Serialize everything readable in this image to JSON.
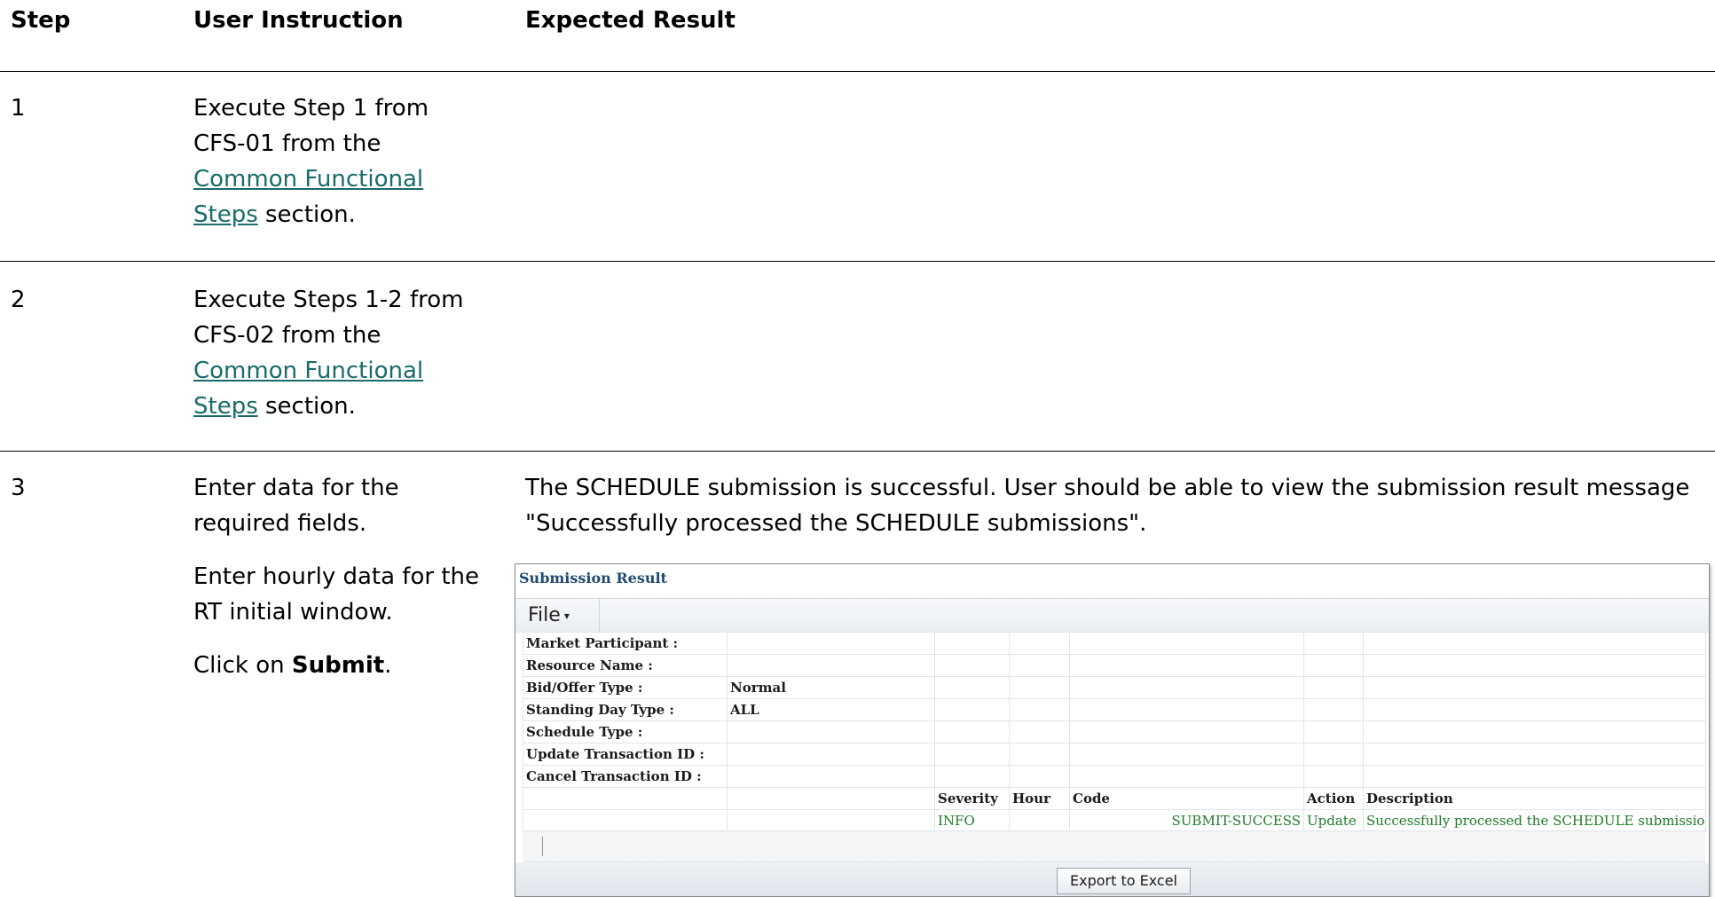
{
  "headers": {
    "step": "Step",
    "instruction": "User Instruction",
    "expected": "Expected Result"
  },
  "rows": [
    {
      "step": "1",
      "instr_line1": "Execute Step 1 from",
      "instr_line2": "CFS-01 from the",
      "link_text_a": "Common Functional",
      "link_text_b": "Steps",
      "instr_tail": " section."
    },
    {
      "step": "2",
      "instr_line1": "Execute Steps 1-2 from",
      "instr_line2": "CFS-02 from the",
      "link_text_a": "Common Functional",
      "link_text_b": "Steps",
      "instr_tail": " section."
    },
    {
      "step": "3",
      "instr_p1a": "Enter data for the",
      "instr_p1b": "required fields.",
      "instr_p2a": "Enter hourly data for the",
      "instr_p2b": "RT initial window.",
      "instr_p3_prefix": "Click on ",
      "instr_p3_bold": "Submit",
      "instr_p3_suffix": ".",
      "expected_line1": "The SCHEDULE submission is successful. User should be able to view the submission result message",
      "expected_line2": "\"Successfully processed the SCHEDULE submissions\"."
    }
  ],
  "panel": {
    "title": "Submission Result",
    "file_menu": "File",
    "fields": [
      {
        "label": "Market Participant :",
        "value": ""
      },
      {
        "label": "Resource Name :",
        "value": ""
      },
      {
        "label": "Bid/Offer Type :",
        "value": "Normal"
      },
      {
        "label": "Standing Day Type :",
        "value": "ALL"
      },
      {
        "label": "Schedule Type :",
        "value": ""
      },
      {
        "label": "Update Transaction ID :",
        "value": ""
      },
      {
        "label": "Cancel Transaction ID :",
        "value": ""
      }
    ],
    "result_headers": {
      "severity": "Severity",
      "hour": "Hour",
      "code": "Code",
      "action": "Action",
      "description": "Description"
    },
    "result_row": {
      "severity": "INFO",
      "hour": "",
      "code": "SUBMIT-SUCCESS",
      "action": "Update",
      "description": "Successfully processed the SCHEDULE submission."
    },
    "export_button": "Export to Excel"
  }
}
